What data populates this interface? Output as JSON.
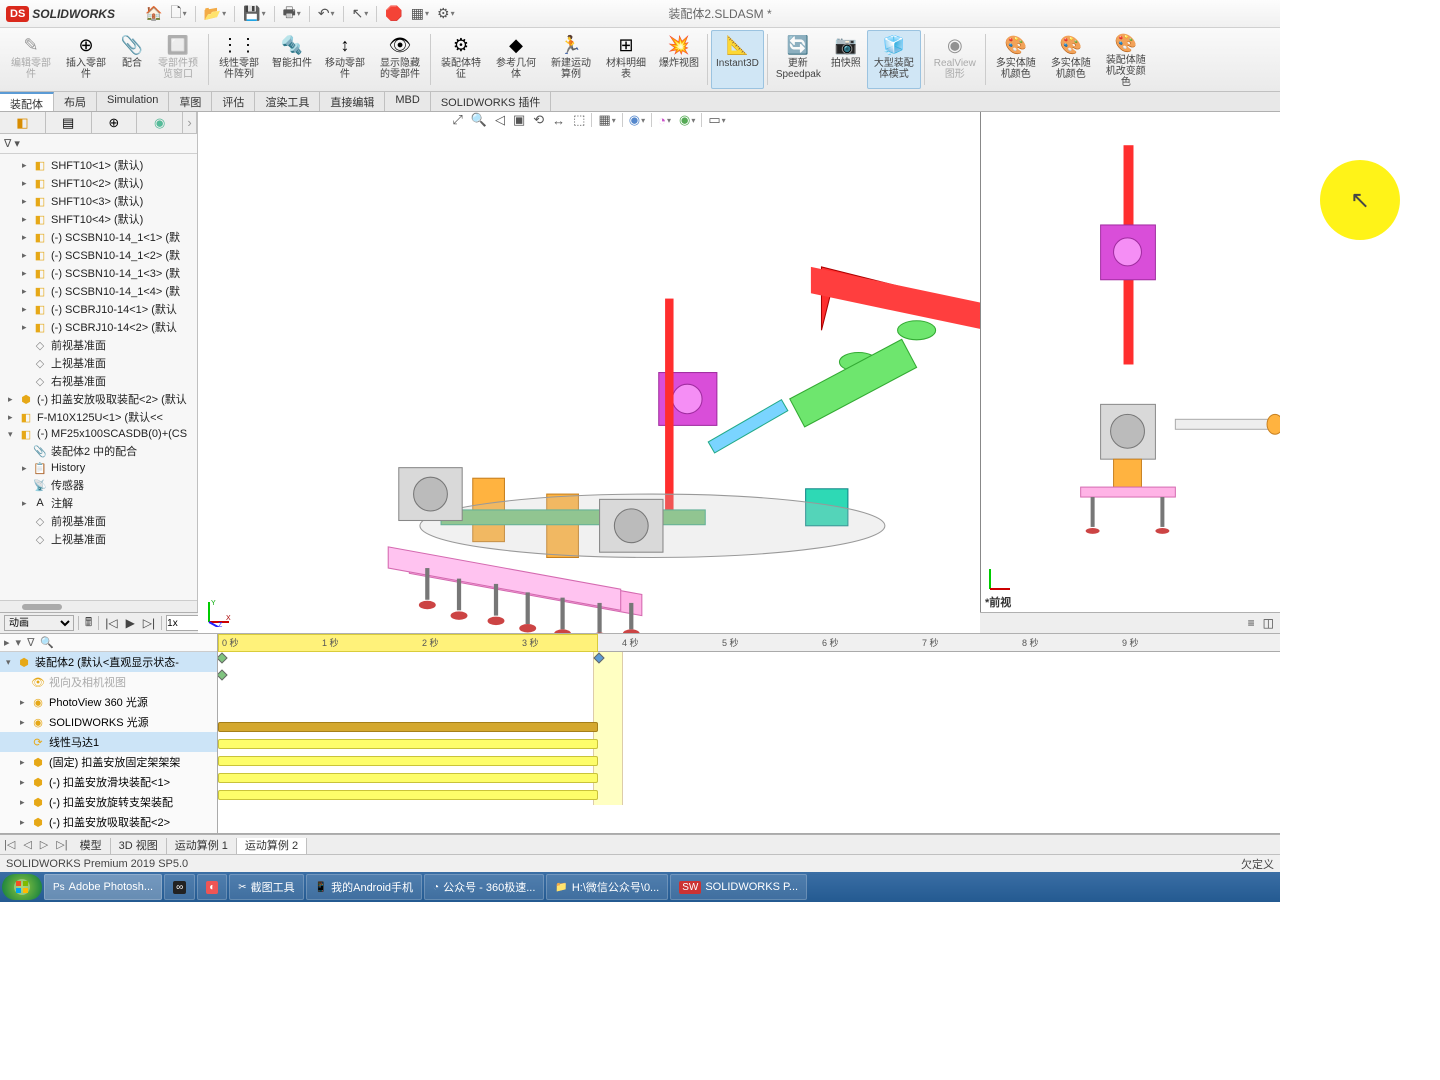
{
  "title": "装配体2.SLDASM *",
  "logo": "SOLIDWORKS",
  "ribbon": [
    {
      "label": "编辑零部件",
      "disabled": true
    },
    {
      "label": "插入零部件"
    },
    {
      "label": "配合"
    },
    {
      "label": "零部件预览窗口",
      "disabled": true
    },
    {
      "label": "线性零部件阵列"
    },
    {
      "label": "智能扣件"
    },
    {
      "label": "移动零部件"
    },
    {
      "label": "显示隐藏的零部件"
    },
    {
      "label": "装配体特征"
    },
    {
      "label": "参考几何体"
    },
    {
      "label": "新建运动算例"
    },
    {
      "label": "材料明细表"
    },
    {
      "label": "爆炸视图"
    },
    {
      "label": "Instant3D",
      "active": true
    },
    {
      "label": "更新Speedpak"
    },
    {
      "label": "拍快照"
    },
    {
      "label": "大型装配体模式",
      "active": true
    },
    {
      "label": "RealView 图形",
      "disabled": true
    },
    {
      "label": "多实体随机颜色"
    },
    {
      "label": "多实体随机颜色"
    },
    {
      "label": "装配体随机改变颜色"
    }
  ],
  "tabs": [
    "装配体",
    "布局",
    "Simulation",
    "草图",
    "评估",
    "渲染工具",
    "直接编辑",
    "MBD",
    "SOLIDWORKS 插件"
  ],
  "tree": [
    {
      "indent": 1,
      "tw": "▸",
      "ico": "part",
      "text": "SHFT10<1> (默认)"
    },
    {
      "indent": 1,
      "tw": "▸",
      "ico": "part",
      "text": "SHFT10<2> (默认)"
    },
    {
      "indent": 1,
      "tw": "▸",
      "ico": "part",
      "text": "SHFT10<3> (默认)"
    },
    {
      "indent": 1,
      "tw": "▸",
      "ico": "part",
      "text": "SHFT10<4> (默认)"
    },
    {
      "indent": 1,
      "tw": "▸",
      "ico": "part",
      "text": "(-) SCSBN10-14_1<1> (默"
    },
    {
      "indent": 1,
      "tw": "▸",
      "ico": "part",
      "text": "(-) SCSBN10-14_1<2> (默"
    },
    {
      "indent": 1,
      "tw": "▸",
      "ico": "part",
      "text": "(-) SCSBN10-14_1<3> (默"
    },
    {
      "indent": 1,
      "tw": "▸",
      "ico": "part",
      "text": "(-) SCSBN10-14_1<4> (默"
    },
    {
      "indent": 1,
      "tw": "▸",
      "ico": "part",
      "text": "(-) SCBRJ10-14<1> (默认"
    },
    {
      "indent": 1,
      "tw": "▸",
      "ico": "part",
      "text": "(-) SCBRJ10-14<2> (默认"
    },
    {
      "indent": 1,
      "tw": "",
      "ico": "plane",
      "text": "前视基准面"
    },
    {
      "indent": 1,
      "tw": "",
      "ico": "plane",
      "text": "上视基准面"
    },
    {
      "indent": 1,
      "tw": "",
      "ico": "plane",
      "text": "右视基准面"
    },
    {
      "indent": 0,
      "tw": "▸",
      "ico": "asm",
      "text": "(-) 扣盖安放吸取装配<2> (默认"
    },
    {
      "indent": 0,
      "tw": "▸",
      "ico": "part",
      "text": "F-M10X125U<1> (默认<<"
    },
    {
      "indent": 0,
      "tw": "▾",
      "ico": "part",
      "text": "(-) MF25x100SCASDB(0)+(CS"
    },
    {
      "indent": 1,
      "tw": "",
      "ico": "mate",
      "text": "装配体2 中的配合"
    },
    {
      "indent": 1,
      "tw": "▸",
      "ico": "hist",
      "text": "History"
    },
    {
      "indent": 1,
      "tw": "",
      "ico": "sens",
      "text": "传感器"
    },
    {
      "indent": 1,
      "tw": "▸",
      "ico": "note",
      "text": "注解"
    },
    {
      "indent": 1,
      "tw": "",
      "ico": "plane",
      "text": "前视基准面"
    },
    {
      "indent": 1,
      "tw": "",
      "ico": "plane",
      "text": "上视基准面"
    }
  ],
  "motion": {
    "mode": "动画",
    "speed": "1x",
    "ruler_ticks": [
      "0 秒",
      "1 秒",
      "2 秒",
      "3 秒",
      "4 秒",
      "5 秒",
      "6 秒",
      "7 秒",
      "8 秒",
      "9 秒"
    ],
    "tree": [
      {
        "tw": "▾",
        "ico": "asm",
        "text": "装配体2 (默认<直观显示状态-",
        "sel": true
      },
      {
        "indent": 1,
        "ico": "cam",
        "text": "视向及相机视图",
        "disabled": true
      },
      {
        "indent": 1,
        "tw": "▸",
        "ico": "pv",
        "text": "PhotoView 360 光源"
      },
      {
        "indent": 1,
        "tw": "▸",
        "ico": "sw",
        "text": "SOLIDWORKS 光源"
      },
      {
        "indent": 1,
        "ico": "mot",
        "text": "线性马达1",
        "sel": true
      },
      {
        "indent": 1,
        "tw": "▸",
        "ico": "asm",
        "text": "(固定) 扣盖安放固定架架架"
      },
      {
        "indent": 1,
        "tw": "▸",
        "ico": "asm",
        "text": "(-) 扣盖安放滑块装配<1>"
      },
      {
        "indent": 1,
        "tw": "▸",
        "ico": "asm",
        "text": "(-) 扣盖安放旋转支架装配"
      },
      {
        "indent": 1,
        "tw": "▸",
        "ico": "asm",
        "text": "(-) 扣盖安放吸取装配<2>"
      }
    ]
  },
  "viewtabs": [
    "模型",
    "3D 视图",
    "运动算例 1",
    "运动算例 2"
  ],
  "viewport2_label": "*前视",
  "status": {
    "left": "SOLIDWORKS Premium 2019 SP5.0",
    "right": "欠定义"
  },
  "taskbar": {
    "items": [
      {
        "ico": "Ps",
        "text": "Adobe Photosh...",
        "active": true
      },
      {
        "ico": "∞",
        "color": "#222"
      },
      {
        "ico": "◐",
        "color": "#e55"
      },
      {
        "ico": "✂",
        "text": "截图工具"
      },
      {
        "ico": "📱",
        "text": "我的Android手机"
      },
      {
        "ico": "◔",
        "text": "公众号 - 360极速..."
      },
      {
        "ico": "📁",
        "text": "H:\\微信公众号\\0..."
      },
      {
        "ico": "SW",
        "text": "SOLIDWORKS P...",
        "color": "#c33"
      }
    ]
  }
}
